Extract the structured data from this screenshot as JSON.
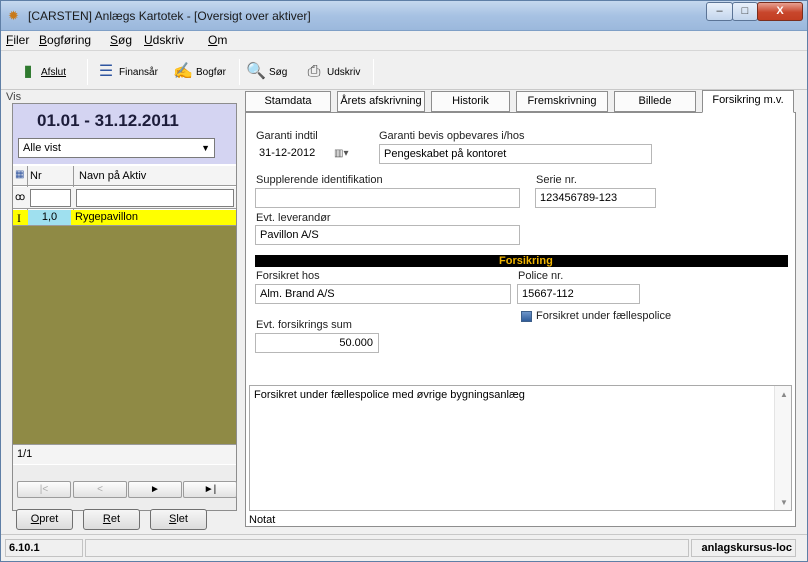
{
  "window": {
    "title": "[CARSTEN] Anlægs Kartotek - [Oversigt over aktiver]",
    "controls": {
      "minimize": "–",
      "maximize": "□",
      "close": "X"
    }
  },
  "menu": [
    "Filer",
    "Bogføring",
    "Søg",
    "Udskriv",
    "Om"
  ],
  "toolbar": {
    "buttons": [
      {
        "label": "Afslut",
        "icon": "exit-door-icon"
      },
      {
        "label": "Finansår",
        "icon": "calendar-lines-icon"
      },
      {
        "label": "Bogfør",
        "icon": "posting-icon"
      },
      {
        "label": "Søg",
        "icon": "magnifier-icon"
      },
      {
        "label": "Udskriv",
        "icon": "printer-icon"
      }
    ]
  },
  "left": {
    "vis_label": "Vis",
    "period": "01.01 - 31.12.2011",
    "filter_selected": "Alle vist",
    "columns": {
      "nr": "Nr",
      "name": "Navn på Aktiv"
    },
    "rows": [
      {
        "indicator": "I",
        "nr": "1,0",
        "name": "Rygepavillon"
      }
    ],
    "count": "1/1",
    "nav": {
      "first": "|<",
      "prev": "<",
      "next": "►",
      "last": "►|"
    },
    "actions": {
      "create": "Opret",
      "edit": "Ret",
      "delete": "Slet"
    }
  },
  "tabs": [
    "Stamdata",
    "Årets afskrivning",
    "Historik",
    "Fremskrivning",
    "Billede",
    "Forsikring m.v."
  ],
  "active_tab": "Forsikring m.v.",
  "form": {
    "garanti_label": "Garanti indtil",
    "garanti_value": "31-12-2012",
    "bevis_label": "Garanti bevis opbevares i/hos",
    "bevis_value": "Pengeskabet på kontoret",
    "supp_label": "Supplerende identifikation",
    "supp_value": "",
    "serie_label": "Serie nr.",
    "serie_value": "123456789-123",
    "lev_label": "Evt. leverandør",
    "lev_value": "Pavillon A/S",
    "section_title": "Forsikring",
    "fors_hos_label": "Forsikret hos",
    "fors_hos_value": "Alm. Brand A/S",
    "police_label": "Police nr.",
    "police_value": "15667-112",
    "faelles_label": "Forsikret under fællespolice",
    "faelles_checked": true,
    "sum_label": "Evt. forsikrings sum",
    "sum_value": "50.000",
    "notes_value": "Forsikret under fællespolice med øvrige bygningsanlæg",
    "notat_label": "Notat"
  },
  "status": {
    "version": "6.10.1",
    "server": "anlagskursus-loc"
  },
  "colors": {
    "period_bg": "#d4d4f2",
    "selected_row": "#ffff00",
    "empty_grid": "#8f8a45",
    "section_bar": "#000000",
    "section_title": "#f0b400"
  }
}
